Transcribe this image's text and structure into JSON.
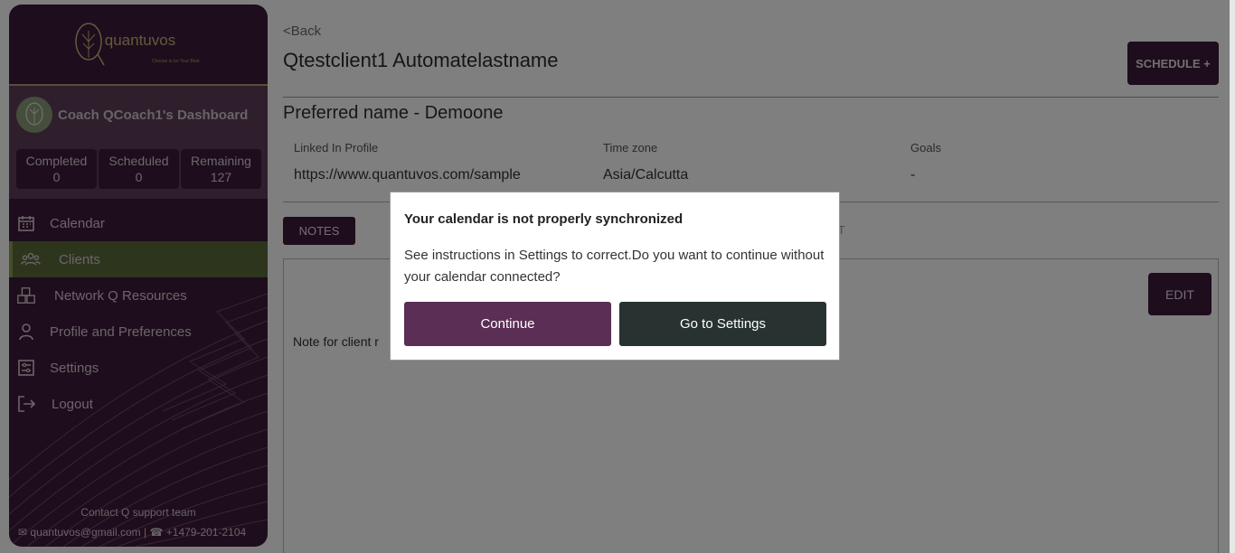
{
  "brand": {
    "name": "quantuvos",
    "tagline": "Choose to be Your Best"
  },
  "coach": {
    "name": "Coach QCoach1's Dashboard"
  },
  "stats": [
    {
      "label": "Completed",
      "value": "0"
    },
    {
      "label": "Scheduled",
      "value": "0"
    },
    {
      "label": "Remaining",
      "value": "127"
    }
  ],
  "nav": [
    {
      "label": "Calendar",
      "icon": "calendar-icon"
    },
    {
      "label": "Clients",
      "icon": "users-icon",
      "active": true
    },
    {
      "label": "Network Q Resources",
      "icon": "boxes-icon"
    },
    {
      "label": "Profile and Preferences",
      "icon": "user-icon"
    },
    {
      "label": "Settings",
      "icon": "settings-icon"
    },
    {
      "label": "Logout",
      "icon": "logout-icon"
    }
  ],
  "contact": {
    "title": "Contact Q support team",
    "email": "quantuvos@gmail.com",
    "separator": "|",
    "phone": "+1479-201-2104"
  },
  "page": {
    "back": "<Back",
    "client_name": "Qtestclient1 Automatelastname",
    "schedule_button": "SCHEDULE +",
    "preferred_name": "Preferred name  - Demoone",
    "fields": [
      {
        "label": "Linked In Profile",
        "value": "https://www.quantuvos.com/sample"
      },
      {
        "label": "Time zone",
        "value": "Asia/Calcutta"
      },
      {
        "label": "Goals",
        "value": "-"
      }
    ],
    "tabs": {
      "notes": "NOTES",
      "chat": "AT"
    },
    "edit_button": "EDIT",
    "note_text": "Note for client r"
  },
  "modal": {
    "title": "Your calendar is not properly synchronized",
    "body": "See instructions in Settings to correct.Do you want to continue without your calendar connected?",
    "continue": "Continue",
    "settings": "Go to Settings"
  },
  "colors": {
    "sidebar": "#3d1b38",
    "accent_green": "#5b6a3a",
    "continue_button": "#5b2e55",
    "settings_button": "#283230"
  }
}
